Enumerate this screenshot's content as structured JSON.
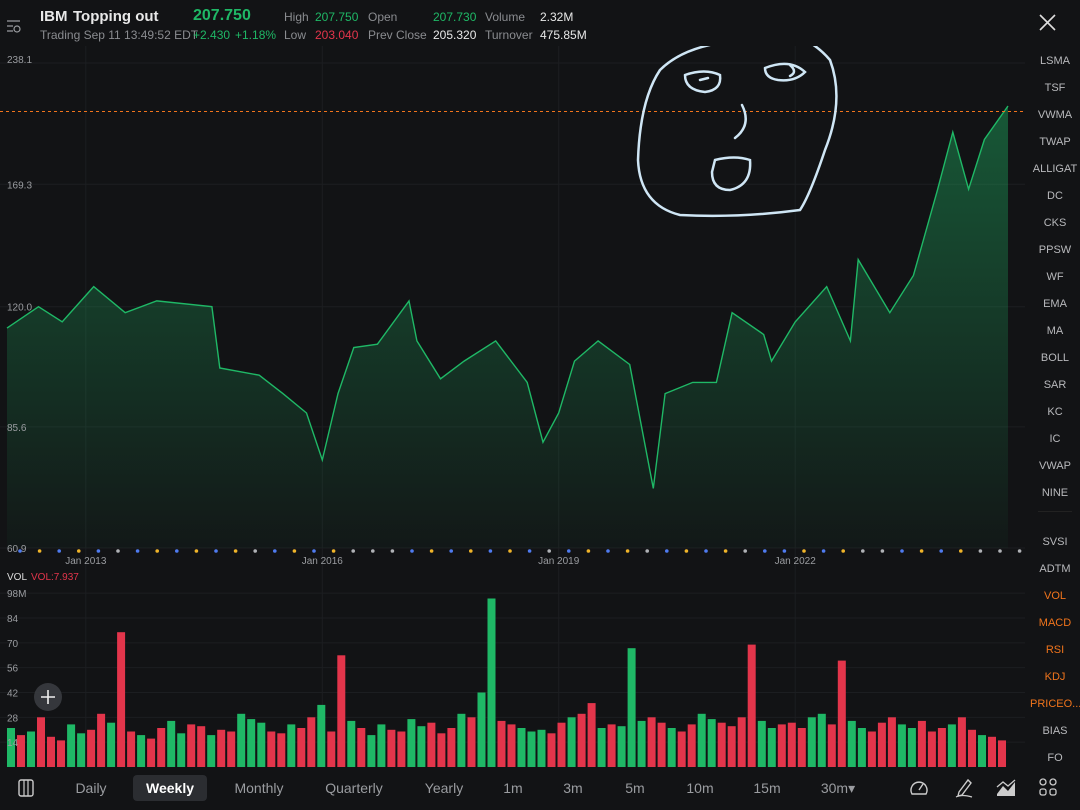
{
  "header": {
    "symbol": "IBM",
    "title": "Topping out",
    "price": "207.750",
    "status": "Trading Sep 11 13:49:52 EDT",
    "change": "+2.430",
    "change_pct": "+1.18%",
    "high_label": "High",
    "high": "207.750",
    "low_label": "Low",
    "low": "203.040",
    "open_label": "Open",
    "open": "207.730",
    "prev_close_label": "Prev Close",
    "prev_close": "205.320",
    "volume_label": "Volume",
    "volume": "2.32M",
    "turnover_label": "Turnover",
    "turnover": "475.85M"
  },
  "colors": {
    "up": "#1fb866",
    "down": "#e3354b",
    "accent": "#f0741c",
    "background": "#121315"
  },
  "indicators": {
    "main": [
      "LSMA",
      "TSF",
      "VWMA",
      "TWAP",
      "ALLIGAT",
      "DC",
      "CKS",
      "PPSW",
      "WF",
      "EMA",
      "MA",
      "BOLL",
      "SAR",
      "KC",
      "IC",
      "VWAP",
      "NINE"
    ],
    "sub": [
      {
        "label": "SVSI",
        "active": false
      },
      {
        "label": "ADTM",
        "active": false
      },
      {
        "label": "VOL",
        "active": true
      },
      {
        "label": "MACD",
        "active": true
      },
      {
        "label": "RSI",
        "active": true
      },
      {
        "label": "KDJ",
        "active": true
      },
      {
        "label": "PRICEO...",
        "active": true
      },
      {
        "label": "BIAS",
        "active": false
      },
      {
        "label": "FO",
        "active": false
      }
    ]
  },
  "timeframes": [
    {
      "label": "Daily"
    },
    {
      "label": "Weekly",
      "active": true
    },
    {
      "label": "Monthly"
    },
    {
      "label": "Quarterly"
    },
    {
      "label": "Yearly"
    },
    {
      "label": "1m"
    },
    {
      "label": "3m"
    },
    {
      "label": "5m"
    },
    {
      "label": "10m"
    },
    {
      "label": "15m"
    },
    {
      "label": "30m▾"
    }
  ],
  "chart_data": [
    {
      "type": "area",
      "scale": "log",
      "ylim": [
        60.9,
        238.1
      ],
      "xlim": [
        2012.0,
        2024.7
      ],
      "y_ticks": [
        "238.1",
        "169.3",
        "120.0",
        "85.6",
        "60.9"
      ],
      "x_ticks": [
        {
          "x": 2013,
          "label": "Jan 2013"
        },
        {
          "x": 2016,
          "label": "Jan 2016"
        },
        {
          "x": 2019,
          "label": "Jan 2019"
        },
        {
          "x": 2022,
          "label": "Jan 2022"
        }
      ],
      "current_price_line": 207.75,
      "x": [
        2012.0,
        2012.4,
        2012.7,
        2013.1,
        2013.5,
        2013.9,
        2014.6,
        2014.7,
        2015.2,
        2015.5,
        2015.8,
        2016.0,
        2016.2,
        2016.4,
        2016.7,
        2017.1,
        2017.2,
        2017.5,
        2017.8,
        2018.2,
        2018.6,
        2018.8,
        2019.0,
        2019.2,
        2019.5,
        2019.9,
        2020.2,
        2020.35,
        2020.7,
        2021.0,
        2021.2,
        2021.6,
        2021.7,
        2022.0,
        2022.4,
        2022.7,
        2022.8,
        2023.2,
        2023.5,
        2023.8,
        2024.0,
        2024.2,
        2024.4,
        2024.7
      ],
      "y": [
        113,
        120,
        115,
        127,
        118,
        122,
        120,
        101,
        99,
        94,
        89,
        78,
        94,
        107,
        108,
        122,
        109,
        98,
        103,
        109,
        97,
        82,
        89,
        103,
        109,
        102,
        72,
        94,
        97,
        97,
        118,
        111,
        103,
        115,
        127,
        109,
        137,
        118,
        131,
        166,
        196,
        167,
        192,
        211
      ]
    },
    {
      "type": "bar",
      "title": "VOL",
      "label": "VOL:7.937",
      "unit": "M",
      "ylim": [
        0,
        98
      ],
      "y_ticks": [
        "98M",
        "84",
        "70",
        "56",
        "42",
        "28",
        "14"
      ],
      "values": [
        22,
        18,
        20,
        28,
        17,
        15,
        24,
        19,
        21,
        30,
        25,
        76,
        20,
        18,
        16,
        22,
        26,
        19,
        24,
        23,
        18,
        21,
        20,
        30,
        27,
        25,
        20,
        19,
        24,
        22,
        28,
        35,
        20,
        63,
        26,
        22,
        18,
        24,
        21,
        20,
        27,
        23,
        25,
        19,
        22,
        30,
        28,
        42,
        95,
        26,
        24,
        22,
        20,
        21,
        19,
        25,
        28,
        30,
        36,
        22,
        24,
        23,
        67,
        26,
        28,
        25,
        22,
        20,
        24,
        30,
        27,
        25,
        23,
        28,
        69,
        26,
        22,
        24,
        25,
        22,
        28,
        30,
        24,
        60,
        26,
        22,
        20,
        25,
        28,
        24,
        22,
        26,
        20,
        22,
        24,
        28,
        21,
        18,
        17,
        15
      ],
      "directions": "ududdduudduddudduuddudduuudduddudduduudduuddduduudduuuddudduduuuddudduudddduuddduudduuddduuddduddu"
    }
  ],
  "event_markers": "bybybgbybybygbybygggbybybybgbybygbybygbbybyggbybyggg"
}
